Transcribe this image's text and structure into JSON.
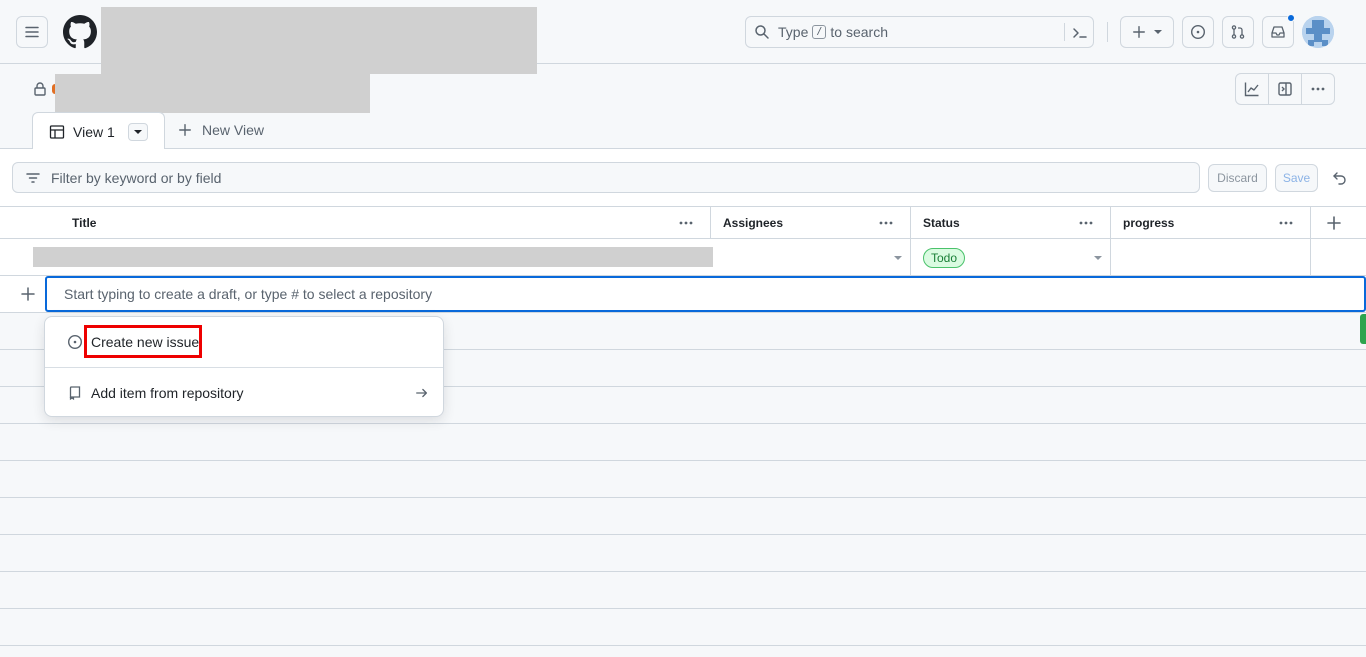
{
  "header": {
    "search_prefix": "Type",
    "search_key": "/",
    "search_suffix": "to search"
  },
  "views": {
    "active_tab": "View 1",
    "new_view": "New View"
  },
  "filter": {
    "placeholder": "Filter by keyword or by field",
    "discard": "Discard",
    "save": "Save"
  },
  "table": {
    "columns": [
      "Title",
      "Assignees",
      "Status",
      "progress"
    ],
    "rows": [
      {
        "title": "",
        "assignees": "",
        "status": "Todo",
        "progress": ""
      }
    ],
    "add_placeholder": "Start typing to create a draft, or type # to select a repository"
  },
  "menu": {
    "items": [
      {
        "label": "Create new issue",
        "icon": "issue-opened-icon"
      },
      {
        "label": "Add item from repository",
        "icon": "repo-icon"
      }
    ]
  },
  "colors": {
    "accent": "#0969da",
    "todo_bg": "#dafbe1",
    "todo_border": "#4ac26b",
    "highlight": "#ee0000"
  }
}
